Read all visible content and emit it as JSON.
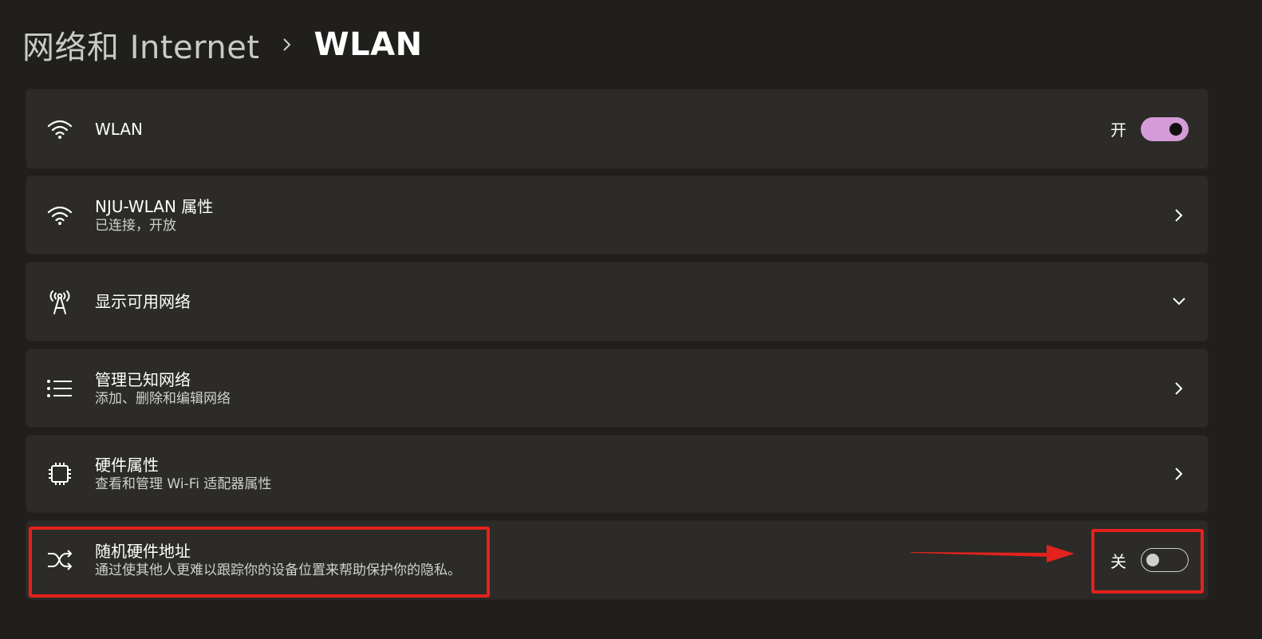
{
  "breadcrumb": {
    "parent": "网络和 Internet",
    "current": "WLAN"
  },
  "wlan": {
    "title": "WLAN",
    "state_label": "开",
    "toggle_on": true,
    "icon": "wifi-icon"
  },
  "network_props": {
    "title": "NJU-WLAN 属性",
    "subtitle": "已连接，开放",
    "icon": "wifi-icon"
  },
  "show_networks": {
    "title": "显示可用网络",
    "icon": "antenna-icon"
  },
  "known_networks": {
    "title": "管理已知网络",
    "subtitle": "添加、删除和编辑网络",
    "icon": "list-icon"
  },
  "hardware_props": {
    "title": "硬件属性",
    "subtitle": "查看和管理 Wi-Fi 适配器属性",
    "icon": "chip-icon"
  },
  "random_hw": {
    "title": "随机硬件地址",
    "subtitle": "通过使其他人更难以跟踪你的设备位置来帮助保护你的隐私。",
    "state_label": "关",
    "toggle_on": false,
    "icon": "shuffle-icon"
  },
  "colors": {
    "background": "#201f1c",
    "card": "#2c2b28",
    "accent": "#d59bd8",
    "annotation": "#e3221c"
  }
}
